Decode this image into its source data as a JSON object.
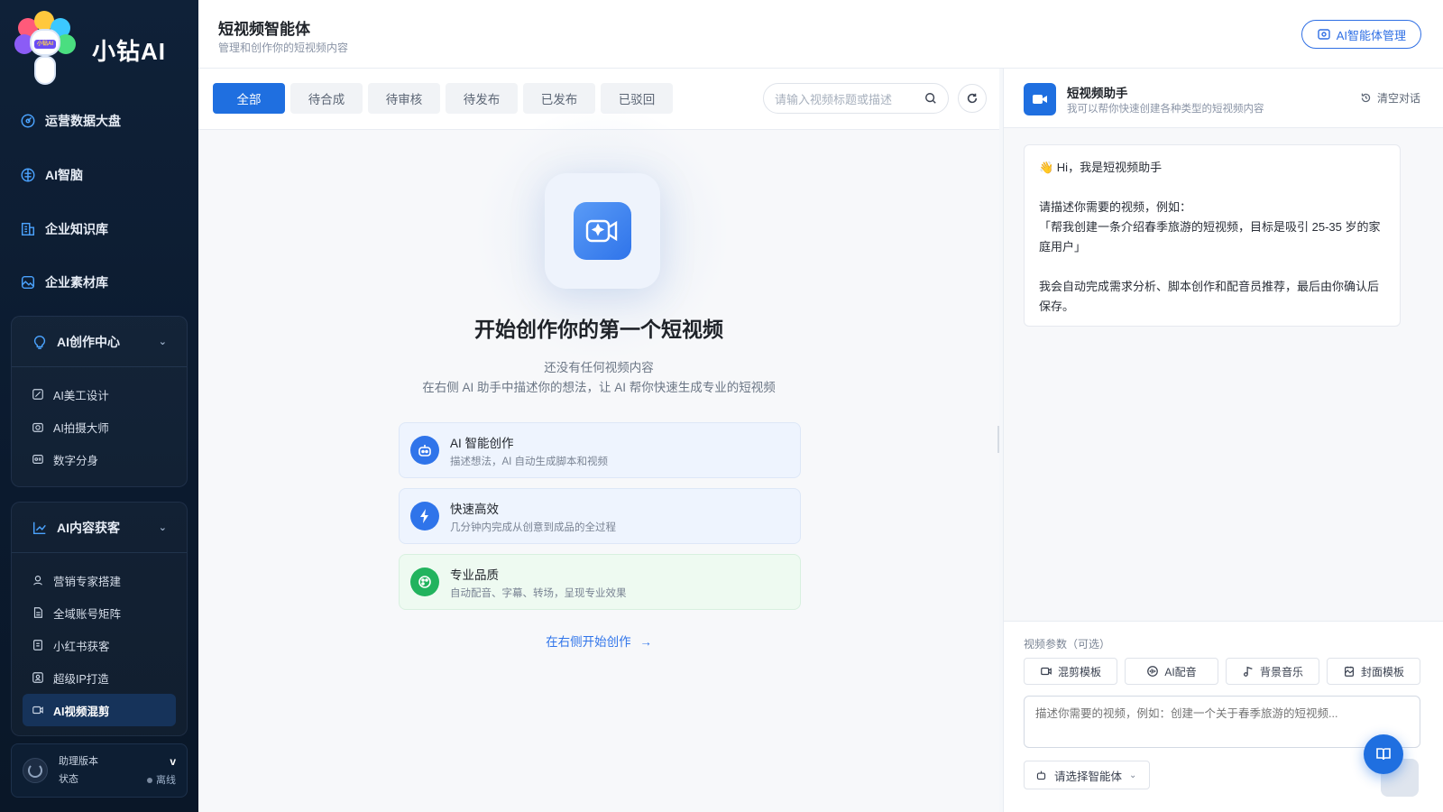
{
  "brand": {
    "name": "小钻AI",
    "mascot_tag": "小钻AI"
  },
  "sidebar": {
    "nav": [
      {
        "label": "运营数据大盘",
        "icon": "dashboard-icon"
      },
      {
        "label": "AI智脑",
        "icon": "brain-icon"
      },
      {
        "label": "企业知识库",
        "icon": "knowledge-base-icon"
      },
      {
        "label": "企业素材库",
        "icon": "image-library-icon"
      }
    ],
    "groups": [
      {
        "label": "AI创作中心",
        "icon": "lightbulb-icon",
        "items": [
          {
            "label": "AI美工设计",
            "icon": "design-icon"
          },
          {
            "label": "AI拍摄大师",
            "icon": "camera-icon"
          },
          {
            "label": "数字分身",
            "icon": "id-card-icon"
          }
        ]
      },
      {
        "label": "AI内容获客",
        "icon": "trend-chart-icon",
        "items": [
          {
            "label": "营销专家搭建",
            "icon": "user-icon"
          },
          {
            "label": "全域账号矩阵",
            "icon": "document-icon"
          },
          {
            "label": "小红书获客",
            "icon": "note-icon"
          },
          {
            "label": "超级IP打造",
            "icon": "badge-icon"
          },
          {
            "label": "AI视频混剪",
            "icon": "video-icon"
          }
        ]
      }
    ],
    "version": {
      "label": "助理版本",
      "status_label": "状态",
      "value": "v",
      "status": "离线"
    }
  },
  "header": {
    "title": "短视频智能体",
    "subtitle": "管理和创作你的短视频内容",
    "manage_button": "AI智能体管理"
  },
  "main": {
    "tabs": [
      "全部",
      "待合成",
      "待审核",
      "待发布",
      "已发布",
      "已驳回"
    ],
    "active_tab": 0,
    "search_placeholder": "请输入视频标题或描述",
    "empty": {
      "title": "开始创作你的第一个短视频",
      "line1": "还没有任何视频内容",
      "line2": "在右侧 AI 助手中描述你的想法，让 AI 帮你快速生成专业的短视频"
    },
    "features": [
      {
        "title": "AI 智能创作",
        "desc": "描述想法，AI 自动生成脚本和视频",
        "icon": "robot-icon"
      },
      {
        "title": "快速高效",
        "desc": "几分钟内完成从创意到成品的全过程",
        "icon": "lightning-icon"
      },
      {
        "title": "专业品质",
        "desc": "自动配音、字幕、转场，呈现专业效果",
        "icon": "palette-icon"
      }
    ],
    "start_link": "在右侧开始创作"
  },
  "assistant": {
    "title": "短视频助手",
    "subtitle": "我可以帮你快速创建各种类型的短视频内容",
    "clear_label": "清空对话",
    "greeting": "👋 Hi，我是短视频助手",
    "prompt_intro": "请描述你需要的视频，例如：",
    "example": "「帮我创建一条介绍春季旅游的短视频，目标是吸引 25-35 岁的家庭用户」",
    "outro": "我会自动完成需求分析、脚本创作和配音员推荐，最后由你确认后保存。",
    "params_label": "视频参数（可选）",
    "params": [
      "混剪模板",
      "AI配音",
      "背景音乐",
      "封面模板"
    ],
    "input_placeholder": "描述你需要的视频，例如：创建一个关于春季旅游的短视频...",
    "agent_select": "请选择智能体"
  },
  "colors": {
    "accent": "#1f6fe0",
    "sidebar_bg": "#0f2138",
    "green": "#22b35e"
  }
}
